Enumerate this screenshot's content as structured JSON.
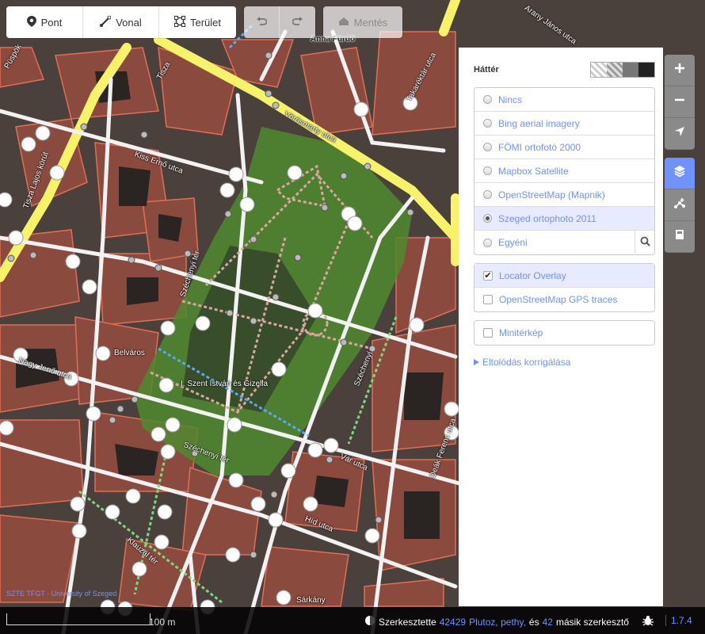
{
  "toolbar": {
    "point_label": "Pont",
    "line_label": "Vonal",
    "area_label": "Terület",
    "save_label": "Mentés"
  },
  "map": {
    "street_labels": [
      "Anna Fürdő",
      "Takaréktár utca",
      "Vörösmarty utca",
      "Kiss Ernő utca",
      "Tisza Lajos körút",
      "Széchenyi tér",
      "Belváros",
      "Nagy Jenő utca",
      "I. Szent István és Gizella",
      "Széchenyi tér",
      "Vár utca",
      "Deák Ferenc utca",
      "Híd utca",
      "Klauzál tér",
      "Sárkány",
      "Arany János utca",
      "Püspök",
      "Tisza",
      "Széchenyi"
    ]
  },
  "background_panel": {
    "title": "Háttér",
    "sources": [
      {
        "label": "Nincs",
        "selected": false
      },
      {
        "label": "Bing aerial imagery",
        "selected": false
      },
      {
        "label": "FÖMI ortofotó 2000",
        "selected": false
      },
      {
        "label": "Mapbox Satellite",
        "selected": false
      },
      {
        "label": "OpenStreetMap (Mapnik)",
        "selected": false
      },
      {
        "label": "Szeged ortophoto 2011",
        "selected": true
      },
      {
        "label": "Egyéni",
        "selected": false
      }
    ],
    "overlays": [
      {
        "label": "Locator Overlay",
        "checked": true
      },
      {
        "label": "OpenStreetMap GPS traces",
        "checked": false
      }
    ],
    "minimap_label": "Minitérkép",
    "offset_label": "Eltolódás korrigálása"
  },
  "footer": {
    "attribution": "SZTE TFGT - University of Szeged",
    "scale_label": "100 m",
    "edited_by": "Szerkesztette",
    "user_count": "42429",
    "users": "Plutoz, pethy,",
    "and_label": "és",
    "others_count": "42",
    "others_label": "másik szerkesztő",
    "version": "1.7.4"
  },
  "colors": {
    "accent": "#7092ff",
    "road_yellow": "#f6f36a",
    "building_outline": "#e06f55",
    "park_green": "#4f8a2e"
  }
}
